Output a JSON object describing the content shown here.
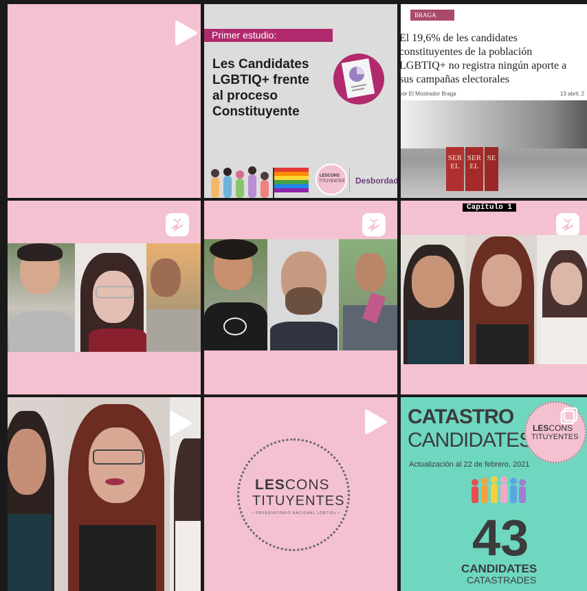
{
  "tiles": {
    "t2": {
      "banner": "Primer estudio:",
      "title_l1": "Les Candidates",
      "title_l2": "LGBTIQ+ frente",
      "title_l3": "al proceso",
      "title_l4": "Constituyente",
      "logo_line1": "LESCONS",
      "logo_line2": "TITUYENTES",
      "partner": "Desbordada"
    },
    "t3": {
      "tag": "BRAGA",
      "headline_l1": "El 19,6% de les candidates",
      "headline_l2": "constituyentes de la población",
      "headline_l3": "LGBTIQ+ no registra ningún aporte a",
      "headline_l4": "sus campañas electorales",
      "byline": "por El Mostrador Braga",
      "date": "13 abril, 2",
      "sign1": "SER EL",
      "sign2": "SER EL",
      "sign3": "SE"
    },
    "t6": {
      "caption": "Capítulo 1"
    },
    "t8": {
      "logo_bold": "LES",
      "logo_rest": "CONS",
      "logo_line2": "TITUYENTES",
      "logo_sub": "• OBSERVATORIO NACIONAL LGBTIQ+ •"
    },
    "t9": {
      "title1": "CATASTRO",
      "title2": "CANDIDATES",
      "update": "Actualización al 22 de febrero, 2021",
      "logo_bold": "LES",
      "logo_rest": "CONS",
      "logo_line2": "TITUYENTES",
      "number": "43",
      "label1": "CANDIDATES",
      "label2": "CATASTRADES"
    }
  },
  "colors": {
    "pink_bg": "#f4c1d1",
    "mint_bg": "#6fd7c0",
    "banner": "#b02a6d"
  },
  "icons": {
    "video": "play-icon",
    "igtv": "igtv-icon",
    "carousel": "carousel-icon"
  }
}
